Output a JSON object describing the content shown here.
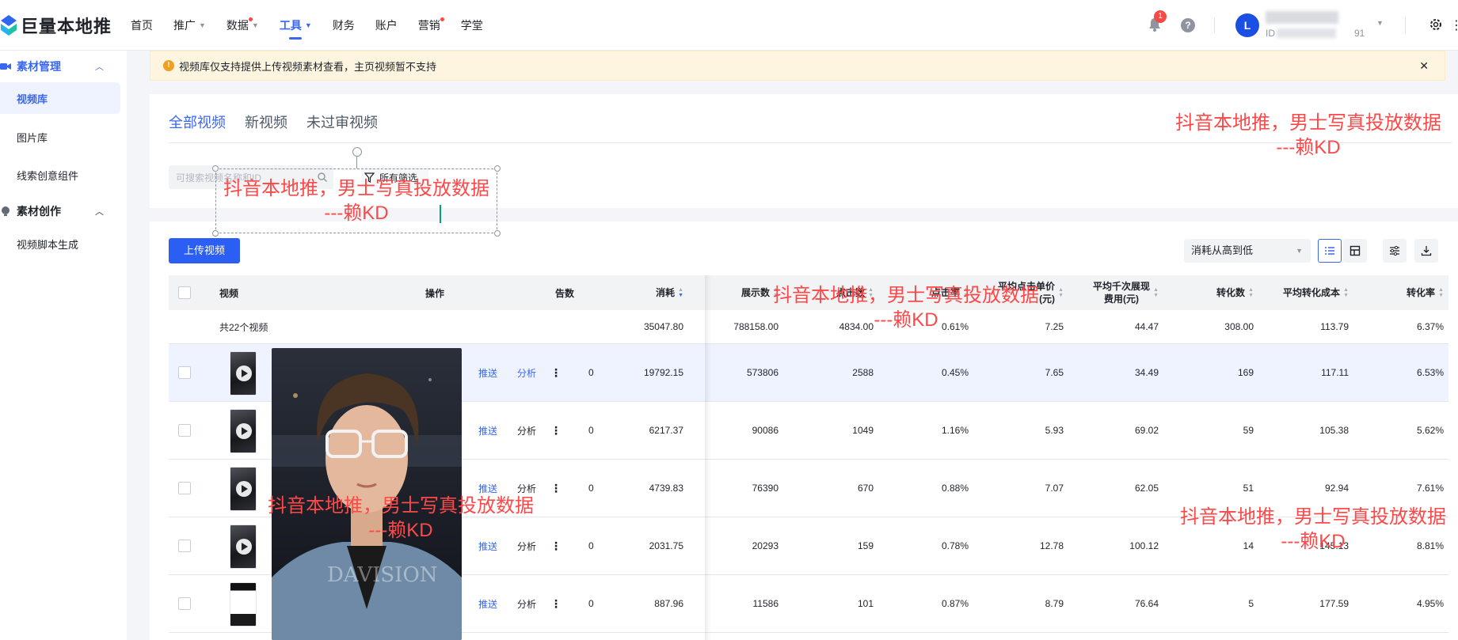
{
  "brand": {
    "logo_text": "巨量本地推"
  },
  "nav": {
    "items": [
      {
        "label": "首页",
        "caret": false,
        "dot": false,
        "active": false
      },
      {
        "label": "推广",
        "caret": true,
        "dot": false,
        "active": false
      },
      {
        "label": "数据",
        "caret": true,
        "dot": true,
        "active": false
      },
      {
        "label": "工具",
        "caret": true,
        "dot": false,
        "active": true
      },
      {
        "label": "财务",
        "caret": false,
        "dot": false,
        "active": false
      },
      {
        "label": "账户",
        "caret": false,
        "dot": false,
        "active": false
      },
      {
        "label": "营销",
        "caret": false,
        "dot": true,
        "active": false
      },
      {
        "label": "学堂",
        "caret": false,
        "dot": false,
        "active": false
      }
    ]
  },
  "header": {
    "notification_count": "1",
    "help_symbol": "?",
    "avatar_letter": "L",
    "account_id_prefix": "ID",
    "account_id_suffix": "91"
  },
  "sidebar": {
    "group1": {
      "label": "素材管理",
      "icon": "video-camera-icon"
    },
    "group1_items": [
      "视频库",
      "图片库",
      "线索创意组件"
    ],
    "group2": {
      "label": "素材创作",
      "icon": "bulb-icon"
    },
    "group2_items": [
      "视频脚本生成"
    ]
  },
  "notice": {
    "text": "视频库仅支持提供上传视频素材查看，主页视频暂不支持"
  },
  "tabs": [
    "全部视频",
    "新视频",
    "未过审视频"
  ],
  "search": {
    "placeholder": "可搜索视频名称和ID"
  },
  "filter": {
    "label": "所有筛选"
  },
  "toolbar": {
    "upload_label": "上传视频",
    "sort_value": "消耗从高到低"
  },
  "table": {
    "headers": {
      "video": "视频",
      "ops": "操作",
      "col_partial": "告数",
      "cost": "消耗",
      "impressions": "展示数",
      "clicks": "点击数",
      "ctr": "点击率",
      "cpc_line1": "平均点击单价",
      "cpc_line2": "(元)",
      "cpm_line1": "平均千次展现",
      "cpm_line2": "费用(元)",
      "conversions": "转化数",
      "cpa": "平均转化成本",
      "cvr": "转化率"
    },
    "summary": {
      "label": "共22个视频",
      "cost": "35047.80",
      "impressions": "788158.00",
      "clicks": "4834.00",
      "ctr": "0.61%",
      "cpc": "7.25",
      "cpm": "44.47",
      "conversions": "308.00",
      "cpa": "113.79",
      "cvr": "6.37%"
    },
    "op_push": "推送",
    "op_analyze": "分析",
    "rows": [
      {
        "partial": "0",
        "cost": "19792.15",
        "impressions": "573806",
        "clicks": "2588",
        "ctr": "0.45%",
        "cpc": "7.65",
        "cpm": "34.49",
        "conversions": "169",
        "cpa": "117.11",
        "cvr": "6.53%"
      },
      {
        "partial": "0",
        "cost": "6217.37",
        "impressions": "90086",
        "clicks": "1049",
        "ctr": "1.16%",
        "cpc": "5.93",
        "cpm": "69.02",
        "conversions": "59",
        "cpa": "105.38",
        "cvr": "5.62%"
      },
      {
        "partial": "0",
        "cost": "4739.83",
        "impressions": "76390",
        "clicks": "670",
        "ctr": "0.88%",
        "cpc": "7.07",
        "cpm": "62.05",
        "conversions": "51",
        "cpa": "92.94",
        "cvr": "7.61%"
      },
      {
        "partial": "0",
        "cost": "2031.75",
        "impressions": "20293",
        "clicks": "159",
        "ctr": "0.78%",
        "cpc": "12.78",
        "cpm": "100.12",
        "conversions": "14",
        "cpa": "145.13",
        "cvr": "8.81%"
      },
      {
        "partial": "0",
        "cost": "887.96",
        "impressions": "11586",
        "clicks": "101",
        "ctr": "0.87%",
        "cpc": "8.79",
        "cpm": "76.64",
        "conversions": "5",
        "cpa": "177.59",
        "cvr": "4.95%"
      }
    ]
  },
  "preview": {
    "watermark": "DAVISION"
  },
  "watermark": {
    "line1": "抖音本地推，男士写真投放数据",
    "line2": "---赖KD"
  }
}
